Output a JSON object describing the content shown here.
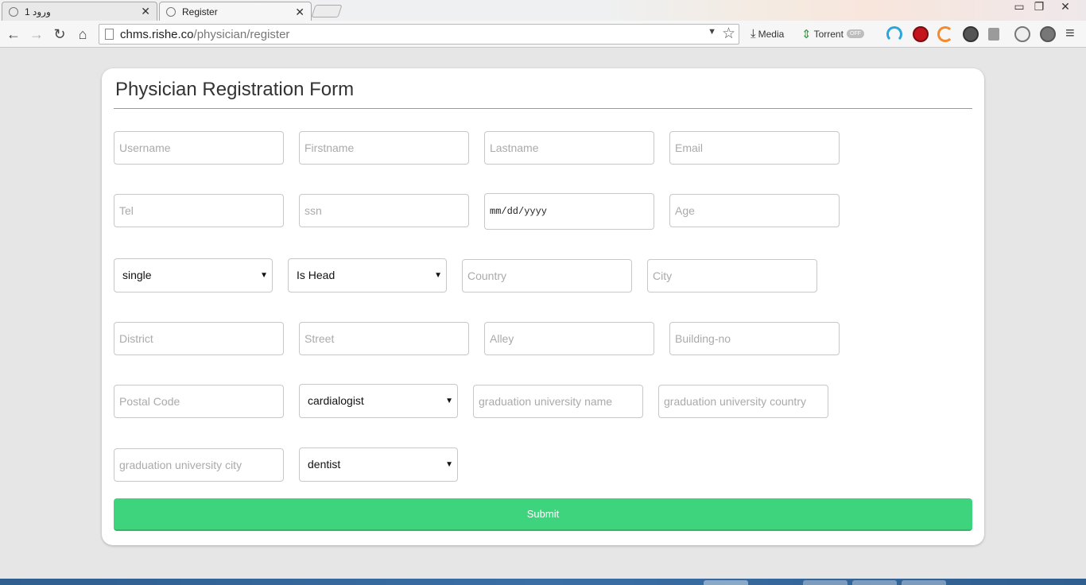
{
  "browser": {
    "tabs": [
      {
        "title": "ورود 1",
        "active": false
      },
      {
        "title": "Register",
        "active": true
      }
    ],
    "url_host": "chms.rishe.co",
    "url_path": "/physician/register",
    "extensions": {
      "media_label": "Media",
      "torrent_label": "Torrent",
      "toggle_label": "OFF"
    }
  },
  "form": {
    "title": "Physician Registration Form",
    "fields": {
      "username": "Username",
      "firstname": "Firstname",
      "lastname": "Lastname",
      "email": "Email",
      "tel": "Tel",
      "ssn": "ssn",
      "birthdate": "mm/dd/yyyy",
      "age": "Age",
      "country": "Country",
      "city": "City",
      "district": "District",
      "street": "Street",
      "alley": "Alley",
      "building_no": "Building-no",
      "postal_code": "Postal Code",
      "grad_uni_name": "graduation university name",
      "grad_uni_country": "graduation university country",
      "grad_uni_city": "graduation university city"
    },
    "selects": {
      "marital_status": "single",
      "is_head": "Is Head",
      "specialty": "cardialogist",
      "profession": "dentist"
    },
    "submit_label": "Submit"
  },
  "colors": {
    "submit_green": "#3ed37d",
    "page_background": "#e6e6e6",
    "taskbar_blue": "#3a6ea5"
  }
}
